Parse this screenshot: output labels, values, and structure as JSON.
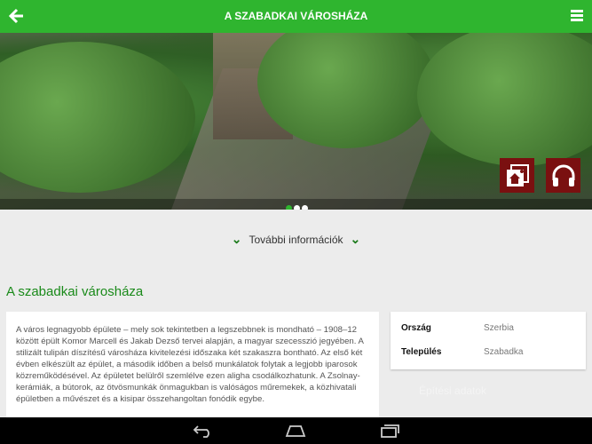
{
  "header": {
    "title": "A SZABADKAI VÁROSHÁZA"
  },
  "gallery": {
    "page_count": 3,
    "active_index": 1
  },
  "more_info": {
    "label": "További információk"
  },
  "section_title": "A szabadkai városháza",
  "description": "A város legnagyobb épülete – mely sok tekintetben a legszebbnek is mondható – 1908–12 között épült Komor Marcell és Jakab Dezső tervei alapján, a magyar szecesszió jegyében. A stilizált tulipán díszítésű városháza kivitelezési időszaka két szakaszra bontható. Az első két évben elkészült az épület, a második időben a belső munkálatok folytak a legjobb iparosok közreműködésével. Az épületet belülről szemlélve ezen aligha csodálkozhatunk. A Zsolnay-kerámiák, a bútorok, az ötvösmunkák önmagukban is valóságos műremekek, a közhivatali épületben a művészet és a kisipar összehangoltan fonódik egybe.",
  "info": {
    "rows": [
      {
        "label": "Ország",
        "value": "Szerbia"
      },
      {
        "label": "Település",
        "value": "Szabadka"
      }
    ],
    "next_section": "Építési adatok"
  },
  "colors": {
    "primary": "#2fb52f",
    "icon_bg": "#7a1010"
  }
}
